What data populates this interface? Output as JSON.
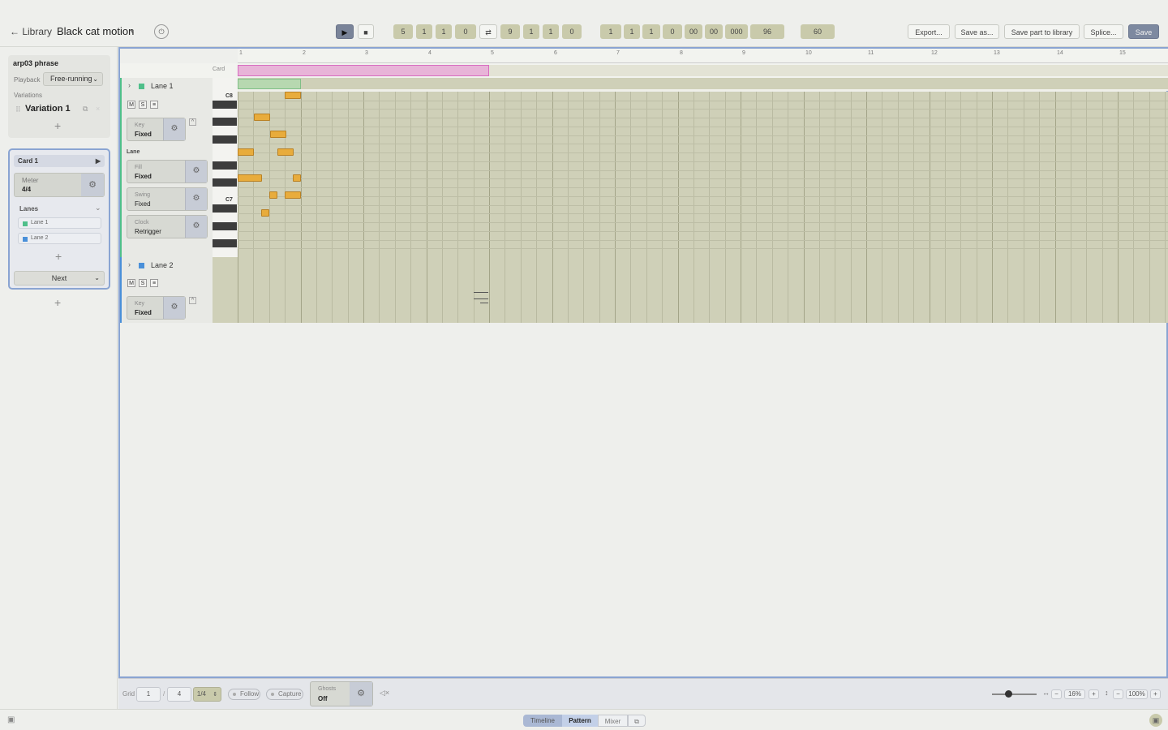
{
  "header": {
    "back_label": "← Library",
    "doc_title": "Black cat motion",
    "title_caret": "▾",
    "power_icon": "⏻",
    "transport": {
      "play": "▶",
      "stop": "■",
      "loop": "⇄"
    },
    "position_fields": [
      "5",
      "1",
      "1",
      "0"
    ],
    "loop_fields": [
      "9",
      "1",
      "1",
      "0"
    ],
    "time_fields": [
      "1",
      "1",
      "1",
      "0",
      "00",
      "00",
      "000",
      "96"
    ],
    "tempo": "60",
    "buttons": {
      "export": "Export...",
      "save_as": "Save as...",
      "save_part": "Save part to library",
      "splice": "Splice...",
      "save": "Save"
    }
  },
  "sidebar": {
    "phrase_name": "arp03 phrase",
    "playback_label": "Playback",
    "playback_value": "Free-running",
    "variations_label": "Variations",
    "variation_name": "Variation 1",
    "card_name": "Card 1",
    "meter_label": "Meter",
    "meter_value": "4/4",
    "lanes_label": "Lanes",
    "lanes": [
      {
        "name": "Lane 1",
        "color": "#4fbf8a"
      },
      {
        "name": "Lane 2",
        "color": "#4a90d9"
      }
    ],
    "next_label": "Next"
  },
  "editor": {
    "card_label": "Card",
    "ruler": [
      "1",
      "2",
      "3",
      "4",
      "5",
      "6",
      "7",
      "8",
      "9",
      "10",
      "11",
      "12",
      "13",
      "14",
      "15"
    ],
    "lane1": {
      "name": "Lane 1",
      "color": "#4fbf8a",
      "m": "M",
      "s": "S",
      "e": "≡",
      "key_label": "Key",
      "key_value": "Fixed",
      "lane_section": "Lane",
      "fill_label": "Fill",
      "fill_value": "Fixed",
      "swing_label": "Swing",
      "swing_value": "Fixed",
      "clock_label": "Clock",
      "clock_value": "Retrigger",
      "c8": "C8",
      "c7": "C7"
    },
    "lane2": {
      "name": "Lane 2",
      "color": "#4a90d9",
      "m": "M",
      "s": "S",
      "e": "≡",
      "key_label": "Key",
      "key_value": "Fixed"
    }
  },
  "bottombar": {
    "grid_label": "Grid",
    "grid_num": "1",
    "grid_sep": "/",
    "grid_den": "4",
    "grid_select": "1/4",
    "follow": "Follow",
    "capture": "Capture",
    "ghosts_label": "Ghosts",
    "ghosts_value": "Off",
    "mute_icon": "🔇",
    "h_zoom": "16%",
    "v_zoom": "100%"
  },
  "footer": {
    "tabs": [
      "Timeline",
      "Pattern",
      "Mixer"
    ],
    "active_tab": "Pattern"
  },
  "colors": {
    "accent": "#8aa4d2",
    "note": "#e8ac3c",
    "grid": "#cfd0b8",
    "card_bar": "#e8b4d8",
    "save": "#7d89a0"
  }
}
